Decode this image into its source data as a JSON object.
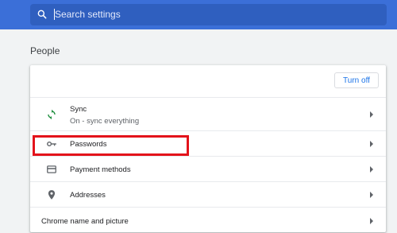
{
  "search": {
    "placeholder": "Search settings",
    "icon": "search-icon"
  },
  "section": {
    "title": "People"
  },
  "card": {
    "turn_off_label": "Turn off",
    "rows": [
      {
        "label": "Sync",
        "sublabel": "On - sync everything",
        "icon": "sync-icon"
      },
      {
        "label": "Passwords",
        "icon": "key-icon"
      },
      {
        "label": "Payment methods",
        "icon": "credit-card-icon"
      },
      {
        "label": "Addresses",
        "icon": "location-pin-icon"
      },
      {
        "label": "Chrome name and picture"
      }
    ]
  },
  "colors": {
    "topbar": "#3b6fd8",
    "accent": "#1a73e8",
    "sync_icon": "#1e8e3e",
    "highlight_box": "#e3131b"
  }
}
